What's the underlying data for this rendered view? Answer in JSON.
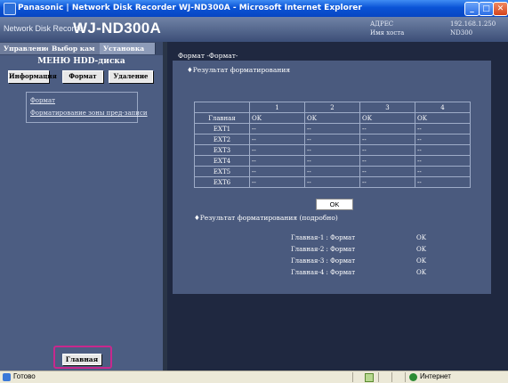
{
  "window": {
    "title": "Panasonic | Network Disk Recorder WJ-ND300A - Microsoft Internet Explorer"
  },
  "header": {
    "product": "Network Disk Recorder",
    "model": "WJ-ND300A",
    "address_label": "АДРЕС",
    "address_value": "192.168.1.250",
    "host_label": "Имя хоста",
    "host_value": "ND300"
  },
  "nav": {
    "tabs": [
      "Управление",
      "Выбор кам",
      "Установка"
    ],
    "menu_title": "МЕНЮ HDD-диска",
    "sub_buttons": [
      "Информация",
      "Формат",
      "Удаление"
    ],
    "links": [
      "Формат",
      "Форматирование зоны пред-записи"
    ],
    "home_label": "Главная"
  },
  "main": {
    "title": "Формат -Формат-",
    "section1": "♦Результат форматирования",
    "table": {
      "columns": [
        "",
        "1",
        "2",
        "3",
        "4"
      ],
      "rows": [
        [
          "Главная",
          "OK",
          "OK",
          "OK",
          "OK"
        ],
        [
          "EXT1",
          "--",
          "--",
          "--",
          "--"
        ],
        [
          "EXT2",
          "--",
          "--",
          "--",
          "--"
        ],
        [
          "EXT3",
          "--",
          "--",
          "--",
          "--"
        ],
        [
          "EXT4",
          "--",
          "--",
          "--",
          "--"
        ],
        [
          "EXT5",
          "--",
          "--",
          "--",
          "--"
        ],
        [
          "EXT6",
          "--",
          "--",
          "--",
          "--"
        ]
      ]
    },
    "ok_label": "OK",
    "section2": "♦Результат форматирования (подробно)",
    "details": [
      {
        "label": "Главная-1 : Формат",
        "value": "OK"
      },
      {
        "label": "Главная-2 : Формат",
        "value": "OK"
      },
      {
        "label": "Главная-3 : Формат",
        "value": "OK"
      },
      {
        "label": "Главная-4 : Формат",
        "value": "OK"
      }
    ]
  },
  "statusbar": {
    "text": "Готово",
    "zone": "Интернет"
  }
}
